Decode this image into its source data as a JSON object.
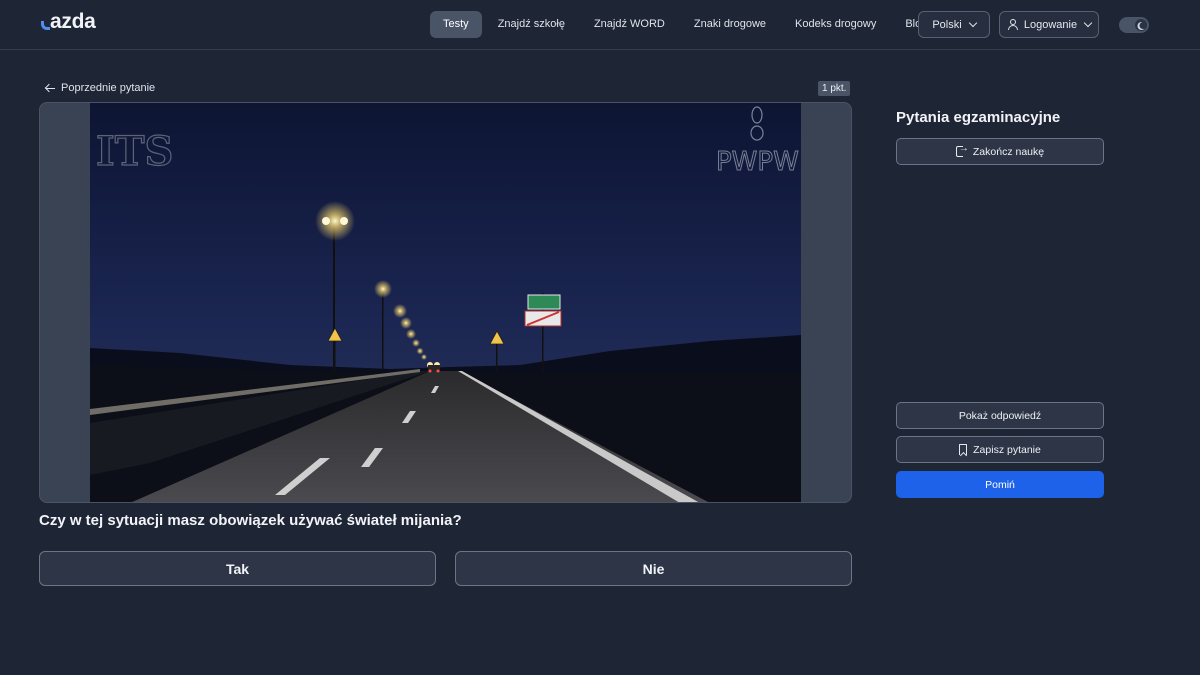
{
  "brand": {
    "logo_text": "azda"
  },
  "nav": {
    "links": [
      {
        "label": "Testy",
        "active": true
      },
      {
        "label": "Znajdź szkołę"
      },
      {
        "label": "Znajdź WORD"
      },
      {
        "label": "Znaki drogowe"
      },
      {
        "label": "Kodeks drogowy"
      },
      {
        "label": "Blog"
      }
    ],
    "language": "Polski",
    "login": "Logowanie"
  },
  "question": {
    "prev_label": "Poprzednie pytanie",
    "points": "1 pkt.",
    "text": "Czy w tej sytuacji masz obowiązek używać świateł mijania?",
    "answers": {
      "yes": "Tak",
      "no": "Nie"
    },
    "media": {
      "watermark_left": "ITS",
      "watermark_right": "PWPW"
    }
  },
  "sidebar": {
    "title": "Pytania egzaminacyjne",
    "finish_label": "Zakończ naukę",
    "show_answer_label": "Pokaż odpowiedź",
    "save_label": "Zapisz pytanie",
    "skip_label": "Pomiń"
  },
  "colors": {
    "background": "#1e2535",
    "accent": "#1d62e9",
    "logo_accent": "#4f8df5"
  }
}
